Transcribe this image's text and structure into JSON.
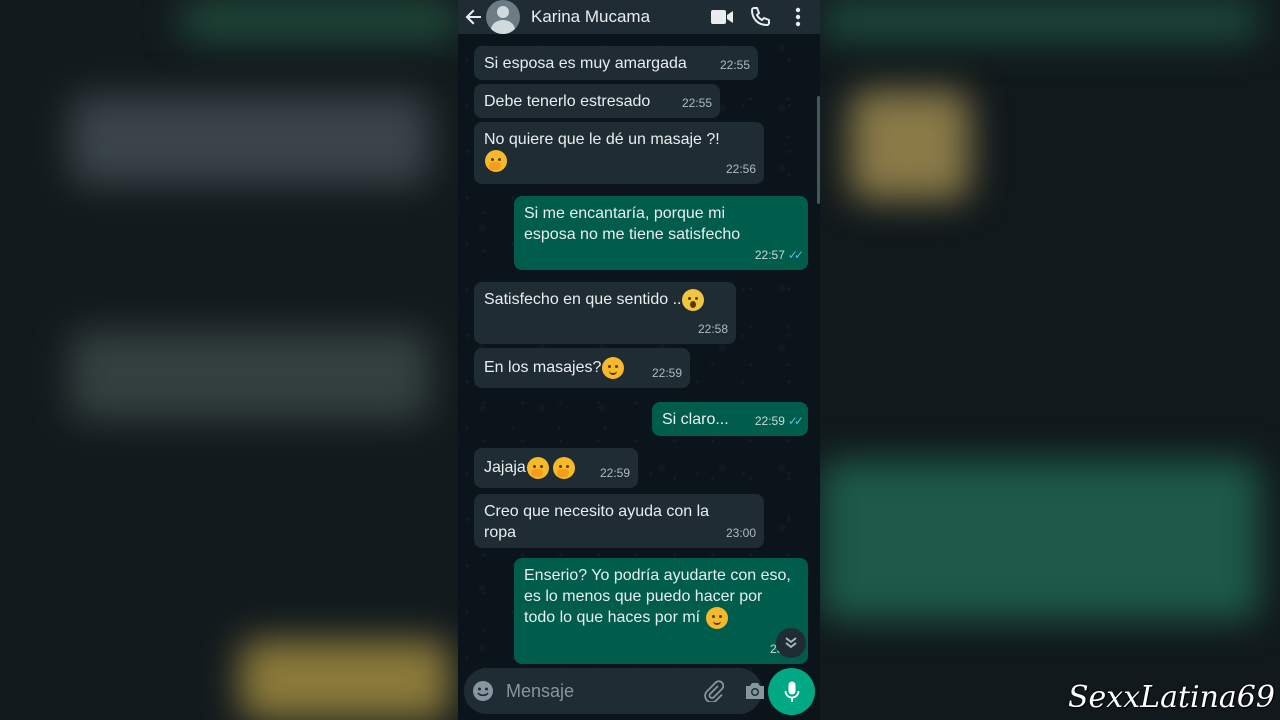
{
  "header": {
    "contact_name": "Karina Mucama"
  },
  "messages": [
    {
      "dir": "in",
      "text": "Si esposa es muy amargada",
      "time": "22:55"
    },
    {
      "dir": "in",
      "text": "Debe tenerlo estresado",
      "time": "22:55"
    },
    {
      "dir": "in",
      "text": "No quiere que le dé un masaje ?!",
      "time": "22:56"
    },
    {
      "dir": "out",
      "text": "Si me encantaría, porque mi esposa no me tiene satisfecho",
      "time": "22:57"
    },
    {
      "dir": "in",
      "text": "Satisfecho en que sentido ..",
      "time": "22:58"
    },
    {
      "dir": "in",
      "text": "En los masajes?",
      "time": "22:59"
    },
    {
      "dir": "out",
      "text": "Si claro...",
      "time": "22:59"
    },
    {
      "dir": "in",
      "text": "Jajaja",
      "time": "22:59"
    },
    {
      "dir": "in",
      "text": "Creo que necesito ayuda con la ropa",
      "time": "23:00"
    },
    {
      "dir": "out",
      "text": "Enserio? Yo podría ayudarte con eso, es lo menos que puedo hacer por todo lo que haces por mí",
      "time": "23:02"
    }
  ],
  "composer": {
    "placeholder": "Mensaje"
  },
  "watermark": "SexxLatina69",
  "colors": {
    "header_bg": "#1f2c34",
    "incoming_bubble": "#1f2c34",
    "outgoing_bubble": "#005c4b",
    "accent": "#00a884",
    "read_ticks": "#53bdeb"
  },
  "icons": [
    "back-arrow-icon",
    "avatar",
    "video-call-icon",
    "phone-call-icon",
    "more-options-icon",
    "emoji-icon",
    "attach-icon",
    "camera-icon",
    "mic-icon",
    "double-chevron-down-icon"
  ]
}
